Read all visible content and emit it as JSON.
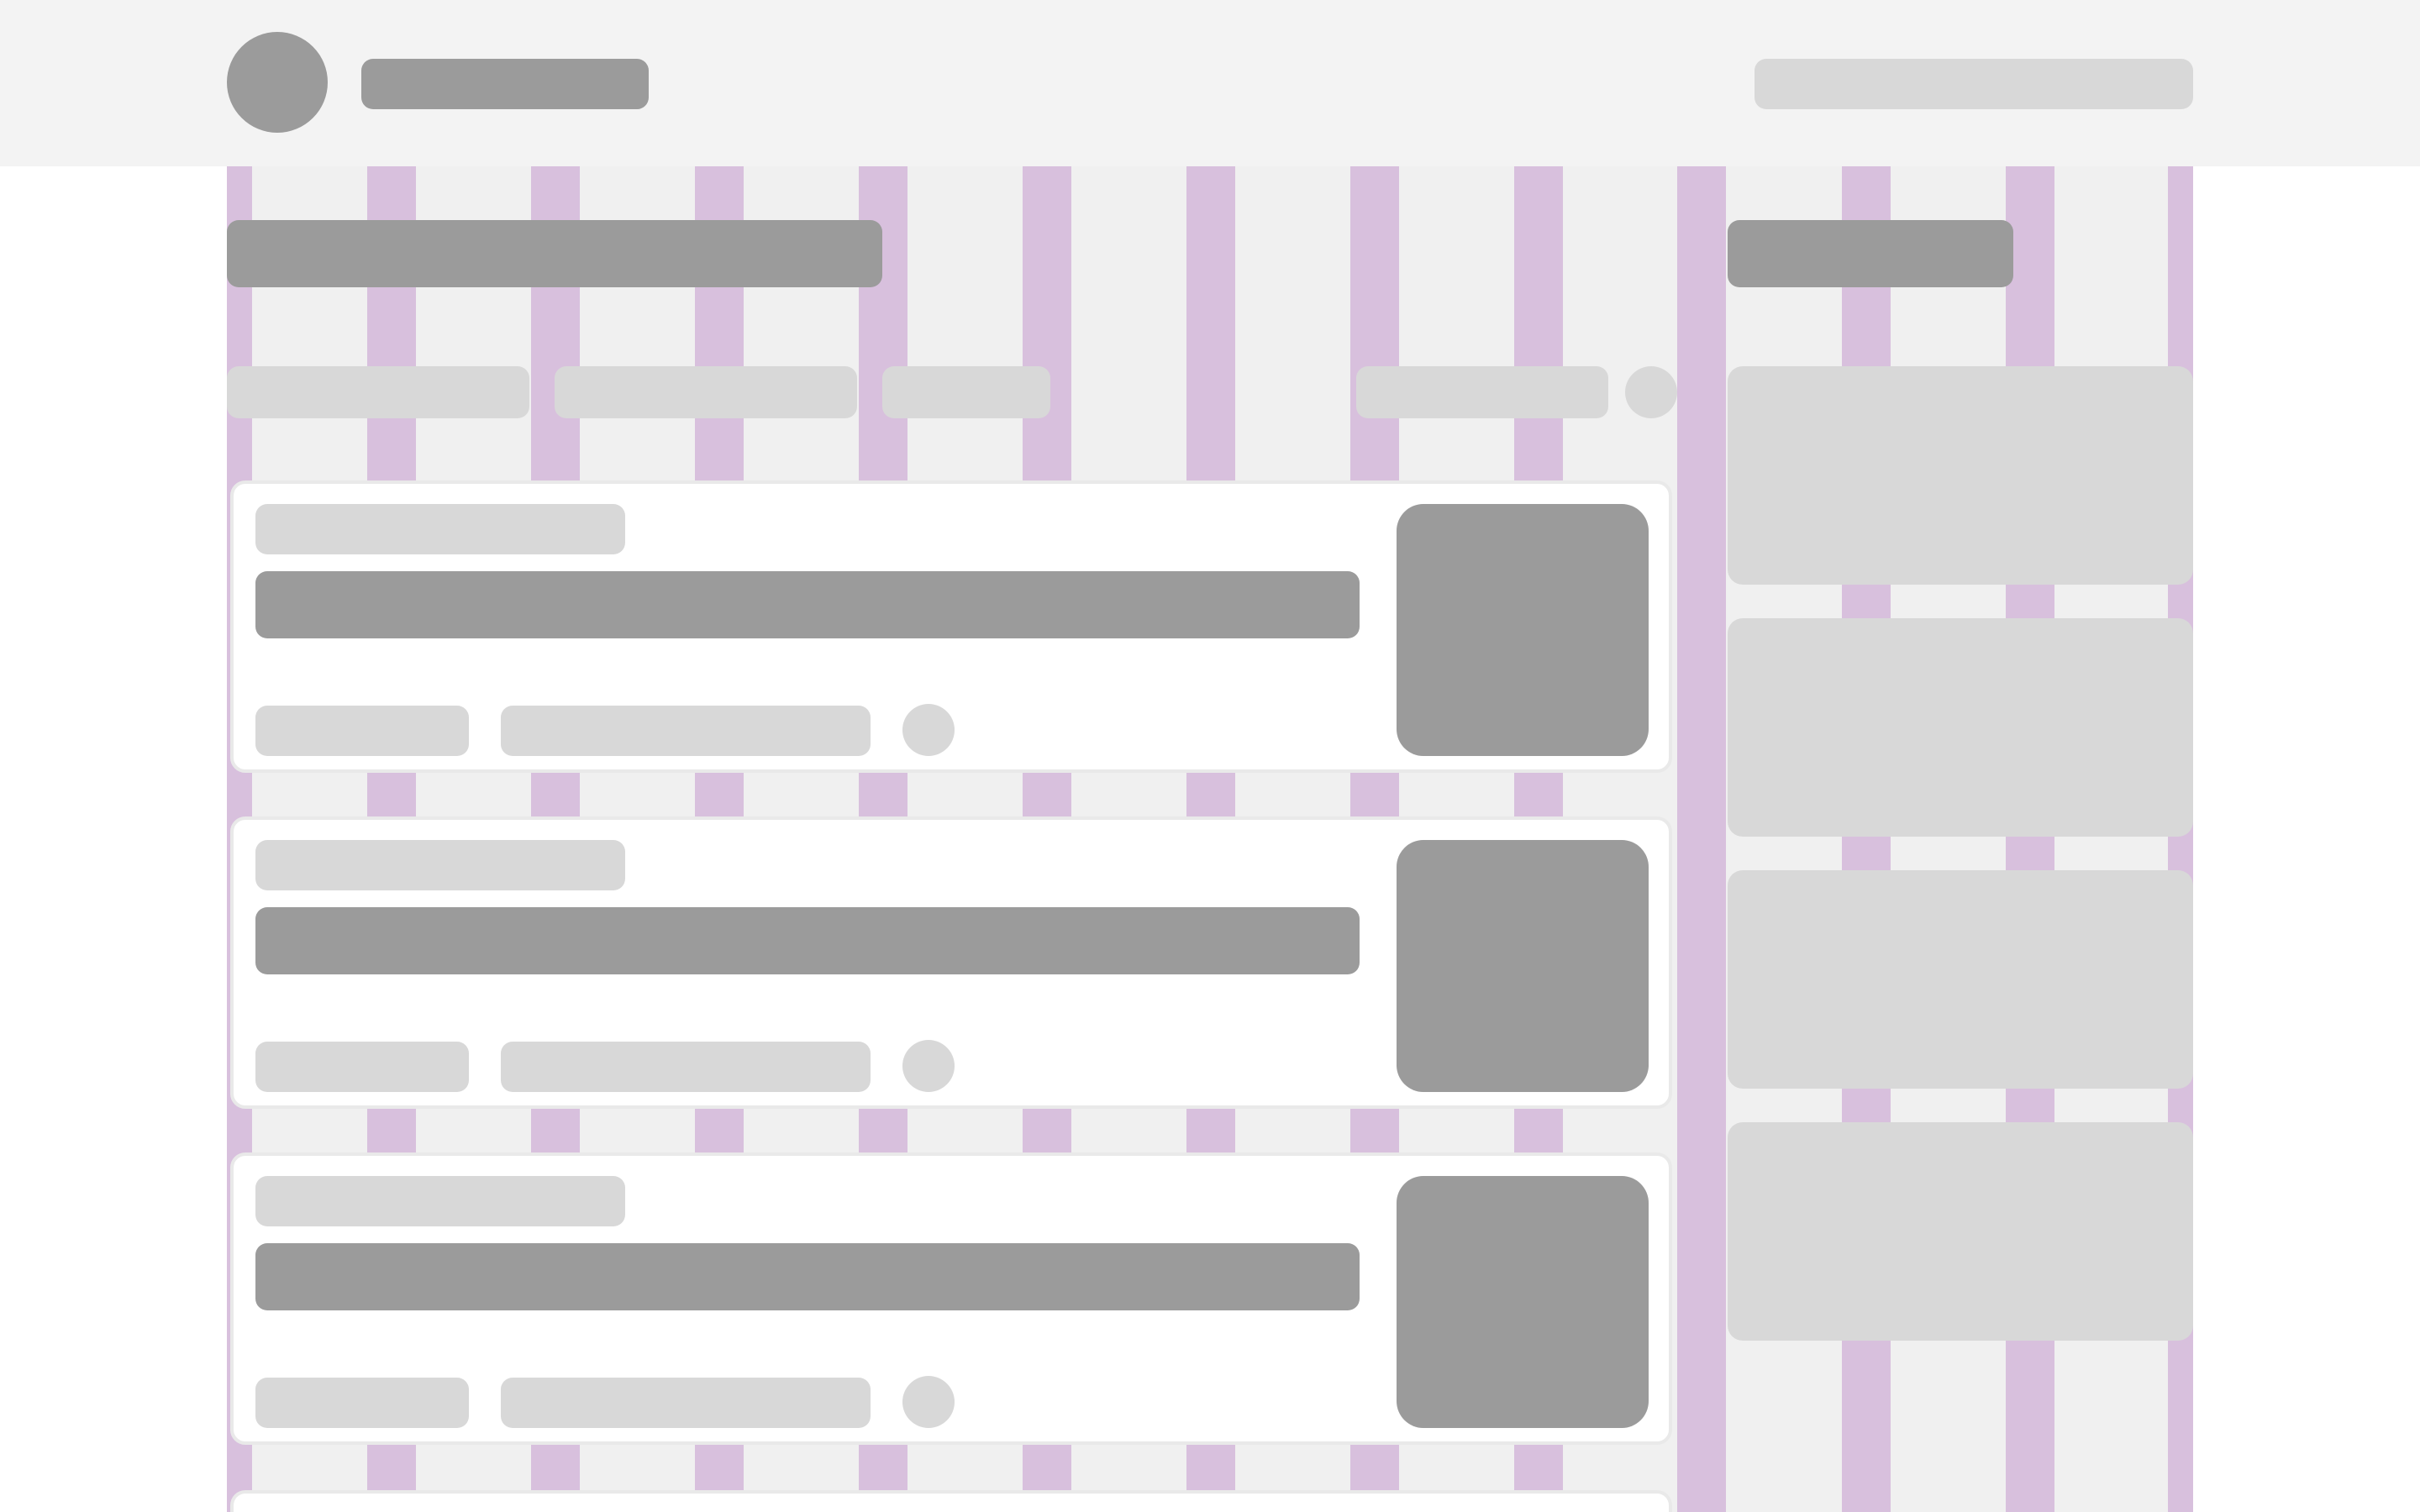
{
  "header": {
    "avatar": "avatar",
    "title": "",
    "search": ""
  },
  "main": {
    "heading": "",
    "filters": [
      "",
      "",
      "",
      ""
    ],
    "cards": [
      {
        "kicker": "",
        "title": "",
        "meta": [
          "",
          ""
        ]
      },
      {
        "kicker": "",
        "title": "",
        "meta": [
          "",
          ""
        ]
      },
      {
        "kicker": "",
        "title": "",
        "meta": [
          "",
          ""
        ]
      }
    ]
  },
  "sidebar": {
    "heading": "",
    "items": [
      "",
      "",
      "",
      ""
    ]
  },
  "colors": {
    "header_bg": "#f3f3f3",
    "grid_bg": "#f0f0f0",
    "grid_stripe": "#d8c0dd",
    "placeholder_dark": "#9b9b9b",
    "placeholder_light": "#d8d8d8",
    "card_bg": "#ffffff",
    "card_border": "#e9e9e9"
  }
}
